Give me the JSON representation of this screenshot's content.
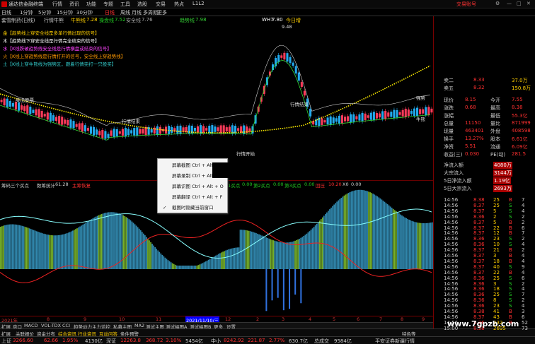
{
  "app": {
    "title": "通达信金融终端",
    "account_label": "交易账号"
  },
  "menu": [
    "行情",
    "资讯",
    "功能",
    "专题",
    "工具",
    "选股",
    "交易",
    "热点",
    "L1L2"
  ],
  "periods": [
    "日线",
    "1分钟",
    "5分钟",
    "15分钟",
    "30分钟",
    "日线",
    "日线",
    "周线",
    "月线",
    "多周期",
    "更多"
  ],
  "chart_info": {
    "name": "套雪制药(日线)",
    "indicator": "行情牛熊",
    "a_label": "牛熊线",
    "a_val": "7.28",
    "b_label": "操盘线",
    "b_val": "7.52",
    "c_label": "安全线",
    "c_val": "7.76",
    "d_label": "趋势线",
    "d_val": "7.98",
    "e_label": "WH7",
    "e_val": "7.80",
    "f_label": "今日增",
    "f_val": ""
  },
  "legend": [
    {
      "text": "金【趋势线上穿安全线是多单行情出现的信号】",
      "color": "#ffd000"
    },
    {
      "text": "木【趋势线下穿安全线是行情完全结束的信号】",
      "color": "#ffffff"
    },
    {
      "text": "水【K线跌破趋势线安全线是行情横盘或结束的信号】",
      "color": "#ff44ff"
    },
    {
      "text": "火【K线上穿趋势线是行情打开的信号，安全线上穿趋势线】",
      "color": "#ff9900"
    },
    {
      "text": "土【K线上穿牛熊线为强势区，跟着行情完打一只股买】",
      "color": "#33cccc"
    }
  ],
  "main_annotations": [
    "9.48",
    "卖出股票",
    "行情结束",
    "行情结束",
    "行情开始",
    "强势",
    "牛熊",
    "4.33",
    "6.33"
  ],
  "sub_info": {
    "name": "筹码三个买点",
    "label2": "数筹统计",
    "val2": "61.28",
    "label3": "主筹恢复",
    "label4": "01买点",
    "val4": "0.00",
    "label5": "第2买点",
    "val5": "0.00",
    "label6": "第3买点",
    "val6": "0.00",
    "label7": "回压",
    "val7": "10.20",
    "label8": "X0",
    "val8": "0.00"
  },
  "sub_axis": [
    "60.00",
    "40.00",
    "20.00",
    "0.00",
    "-20.00",
    "-40.00",
    "-60.00"
  ],
  "x_axis": [
    "2021年",
    "8",
    "9",
    "10",
    "11",
    "2021/11/10/三",
    "12",
    "2",
    "3",
    "4",
    "5",
    "6",
    "7",
    "8",
    "9"
  ],
  "tabs": [
    "扩展",
    "盘口",
    "MACD",
    "VOL-TDX",
    "CCI",
    "趋势动力",
    "主力监控",
    "私募主图",
    "MA2",
    "测试主图",
    "测试幅图A",
    "测试幅图B",
    "更多",
    "设置"
  ],
  "bottom_tabs": [
    "扩展",
    "关联报价",
    "资金分布",
    "综合资讯",
    "行业资讯",
    "互动问答",
    "条件预警",
    "特色等"
  ],
  "status": [
    {
      "name": "上证",
      "v1": "3266.60",
      "v2": "62.66",
      "v3": "1.95%",
      "v4": "4130亿"
    },
    {
      "name": "深证",
      "v1": "12263.8",
      "v2": "368.72",
      "v3": "3.10%",
      "v4": "5454亿"
    },
    {
      "name": "中小",
      "v1": "8242.92",
      "v2": "221.87",
      "v3": "2.77%",
      "v4": "630.7亿"
    },
    {
      "name": "总成交",
      "v1": "9584亿",
      "v2": "",
      "v3": "",
      "v4": ""
    }
  ],
  "status_right": "平安证券新疆行情",
  "context_menu": [
    {
      "label": "屏幕截图 Ctrl + Alt + A",
      "checked": false
    },
    {
      "label": "屏幕录制 Ctrl + Alt + ",
      "checked": false
    },
    {
      "label": "屏幕识图 Ctrl + Alt + O",
      "checked": false
    },
    {
      "label": "屏幕翻译 Ctrl + Alt + F",
      "checked": false
    },
    {
      "label": "截图时隐藏当前窗口",
      "checked": true
    }
  ],
  "quote_panel": {
    "asks": [
      {
        "label": "卖二",
        "price": "8.33",
        "vol": "37.0万"
      },
      {
        "label": "卖五",
        "price": "8.32",
        "vol": "150.8万"
      }
    ],
    "info": [
      {
        "k": "现价",
        "v": "8.15",
        "k2": "今开",
        "v2": "7.55"
      },
      {
        "k": "涨跌",
        "v": "0.68",
        "k2": "最高",
        "v2": "8.38"
      },
      {
        "k": "涨幅",
        "v": "",
        "k2": "最低",
        "v2": "55.3亿"
      },
      {
        "k": "总量",
        "v": "11150",
        "k2": "量比",
        "v2": "871999"
      },
      {
        "k": "现量",
        "v": "463401",
        "k2": "外盘",
        "v2": "408598"
      },
      {
        "k": "换手",
        "v": "13.27%",
        "k2": "股本",
        "v2": "6.61亿"
      },
      {
        "k": "净资",
        "v": "5.51",
        "k2": "流通",
        "v2": "6.09亿"
      },
      {
        "k": "收益(三)",
        "v": "0.030",
        "k2": "PE(动)",
        "v2": "281.5"
      }
    ],
    "flows": [
      {
        "label": "净流入额",
        "v": "4080万"
      },
      {
        "label": "大宗流入",
        "v": "3144万"
      },
      {
        "label": "5日净流入额",
        "v": "1.19亿"
      },
      {
        "label": "5日大宗流入",
        "v": "2693万"
      }
    ],
    "ticks": [
      {
        "t": "14:56",
        "p": "8.38",
        "v": "25",
        "s": "B",
        "n": "7"
      },
      {
        "t": "14:56",
        "p": "8.37",
        "v": "25",
        "s": "S",
        "n": "4"
      },
      {
        "t": "14:56",
        "p": "8.37",
        "v": "5",
        "s": "S",
        "n": "4"
      },
      {
        "t": "14:56",
        "p": "8.36",
        "v": "2",
        "s": "S",
        "n": "2"
      },
      {
        "t": "14:56",
        "p": "8.37",
        "v": "5",
        "s": "B",
        "n": "2"
      },
      {
        "t": "14:56",
        "p": "8.37",
        "v": "22",
        "s": "B",
        "n": "6"
      },
      {
        "t": "14:56",
        "p": "8.37",
        "v": "12",
        "s": "B",
        "n": "7"
      },
      {
        "t": "14:56",
        "p": "8.36",
        "v": "23",
        "s": "S",
        "n": "2"
      },
      {
        "t": "14:56",
        "p": "8.36",
        "v": "10",
        "s": "S",
        "n": "4"
      },
      {
        "t": "14:56",
        "p": "8.37",
        "v": "21",
        "s": "B",
        "n": "2"
      },
      {
        "t": "14:56",
        "p": "8.37",
        "v": "3",
        "s": "B",
        "n": "4"
      },
      {
        "t": "14:56",
        "p": "8.37",
        "v": "18",
        "s": "B",
        "n": "4"
      },
      {
        "t": "14:56",
        "p": "8.37",
        "v": "40",
        "s": "S",
        "n": "9"
      },
      {
        "t": "14:56",
        "p": "8.37",
        "v": "22",
        "s": "B",
        "n": "4"
      },
      {
        "t": "14:56",
        "p": "8.36",
        "v": "25",
        "s": "S",
        "n": "6"
      },
      {
        "t": "14:56",
        "p": "8.36",
        "v": "3",
        "s": "S",
        "n": "2"
      },
      {
        "t": "14:56",
        "p": "8.36",
        "v": "18",
        "s": "S",
        "n": "4"
      },
      {
        "t": "14:56",
        "p": "8.36",
        "v": "25",
        "s": "S",
        "n": "7"
      },
      {
        "t": "14:56",
        "p": "8.36",
        "v": "8",
        "s": "S",
        "n": "2"
      },
      {
        "t": "14:56",
        "p": "8.36",
        "v": "23",
        "s": "S",
        "n": "4"
      },
      {
        "t": "14:56",
        "p": "8.38",
        "v": "41",
        "s": "B",
        "n": "3"
      },
      {
        "t": "14:56",
        "p": "8.37",
        "v": "43",
        "s": "B",
        "n": "6"
      },
      {
        "t": "14:56",
        "p": "8.36",
        "v": "932",
        "s": "B",
        "n": "52"
      },
      {
        "t": "15:00",
        "p": "8.38",
        "v": "2695",
        "s": "",
        "n": "73"
      }
    ],
    "price_axis": [
      "8.32",
      "8.00",
      "7.75",
      "7.50",
      "7.25",
      "7.00",
      "6.75",
      "6.50",
      "6.25",
      "6.00",
      "5.75"
    ],
    "badge": "43.12",
    "toolbar_label": "AI分析"
  },
  "watermark": "www.7gpzb.com"
}
